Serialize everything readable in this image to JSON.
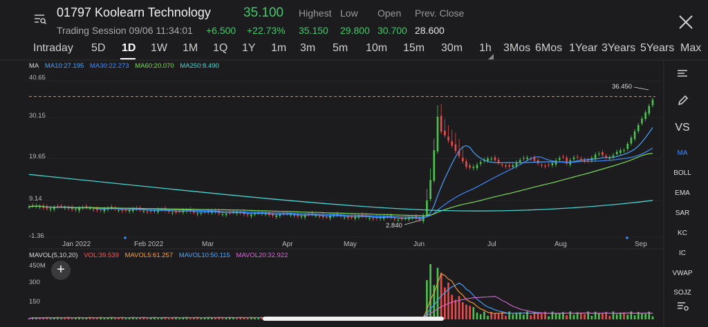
{
  "header": {
    "title": "01797 Koolearn Technology",
    "price": "35.100",
    "session": "Trading Session 09/06 11:34:01",
    "change": "+6.500",
    "change_pct": "+22.73%",
    "quote_labels": [
      "Highest",
      "Low",
      "Open",
      "Prev. Close"
    ],
    "quote_values": [
      "35.150",
      "29.800",
      "30.700",
      "28.600"
    ],
    "up_color": "#3fca6b"
  },
  "tabs": [
    "Intraday",
    "5D",
    "1D",
    "1W",
    "1M",
    "1Q",
    "1Y",
    "1m",
    "3m",
    "5m",
    "10m",
    "15m",
    "30m",
    "1h",
    "3Mos",
    "6Mos",
    "1Year",
    "3Years",
    "5Years",
    "Max"
  ],
  "active_tab": "1D",
  "ma_legend": {
    "label": "MA",
    "ma10": "MA10:27.195",
    "ma30": "MA30:22.273",
    "ma60": "MA60:20.070",
    "ma250": "MA250:8.490"
  },
  "y_ticks": [
    "40.65",
    "30.15",
    "19.65",
    "9.14",
    "-1.36"
  ],
  "x_ticks": [
    "Jan 2022",
    "Feb 2022",
    "Mar",
    "Apr",
    "May",
    "Jun",
    "Jul",
    "Aug",
    "Sep"
  ],
  "max_label": "36.450",
  "min_label": "2.840",
  "vol_legend": {
    "label": "MAVOL(5,10,20)",
    "vol": "VOL:39.539",
    "mavol5": "MAVOL5:61.257",
    "mavol10": "MAVOL10:50.115",
    "mavol20": "MAVOL20:32.922"
  },
  "vol_ticks": [
    "450M",
    "300",
    "150"
  ],
  "sidebar": {
    "items": [
      "VS",
      "MA",
      "BOLL",
      "EMA",
      "SAR",
      "KC",
      "IC",
      "VWAP",
      "SOJZ"
    ],
    "active": "MA"
  },
  "colors": {
    "ma10": "#e8e8e8",
    "ma30": "#3d8bff",
    "ma60": "#7ed957",
    "ma250": "#46d6d2",
    "vol": "#ff5a5a",
    "mavol5": "#ff9f2e",
    "mavol10": "#4aa8ff",
    "mavol20": "#d86ad8",
    "up": "#49c74f",
    "down": "#ee4b4b"
  }
}
